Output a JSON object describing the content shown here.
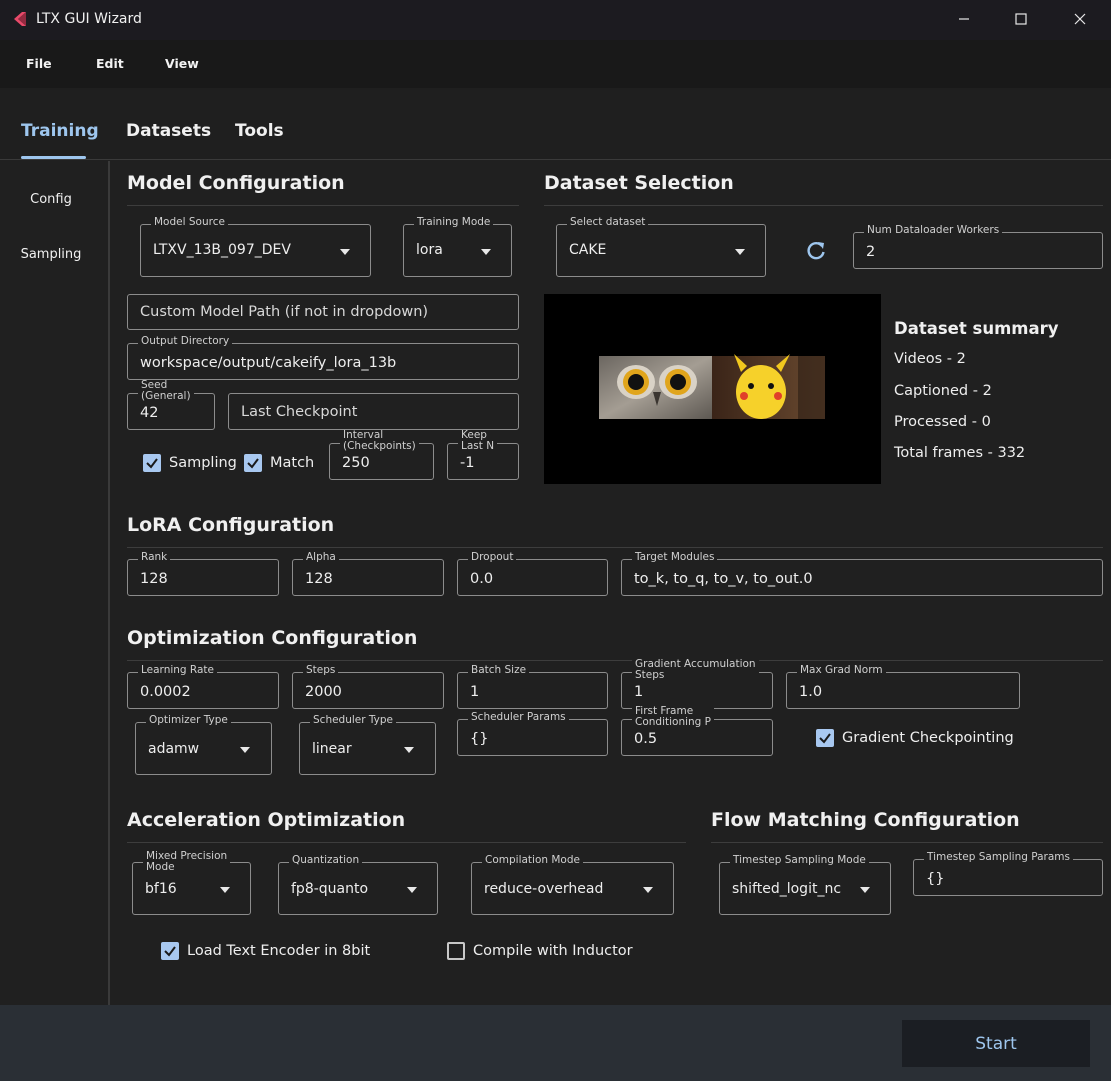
{
  "window": {
    "title": "LTX GUI Wizard"
  },
  "menu": {
    "file": "File",
    "edit": "Edit",
    "view": "View"
  },
  "tabs": {
    "training": "Training",
    "datasets": "Datasets",
    "tools": "Tools"
  },
  "sidenav": {
    "config": "Config",
    "sampling": "Sampling"
  },
  "model": {
    "title": "Model Configuration",
    "source_label": "Model Source",
    "source_value": "LTXV_13B_097_DEV",
    "mode_label": "Training Mode",
    "mode_value": "lora",
    "custom_path_placeholder": "Custom Model Path (if not in dropdown)",
    "output_label": "Output Directory",
    "output_value": "workspace/output/cakeify_lora_13b",
    "seed_label_1": "Seed",
    "seed_label_2": "(General)",
    "seed_value": "42",
    "last_checkpoint_placeholder": "Last Checkpoint",
    "sampling_label": "Sampling",
    "match_label": "Match",
    "interval_label_1": "Interval",
    "interval_label_2": "(Checkpoints)",
    "interval_value": "250",
    "keep_label_1": "Keep",
    "keep_label_2": "Last N",
    "keep_value": "-1"
  },
  "dataset": {
    "title": "Dataset Selection",
    "select_label": "Select dataset",
    "select_value": "CAKE",
    "workers_label": "Num Dataloader Workers",
    "workers_value": "2",
    "summary_title": "Dataset summary",
    "videos": "Videos - 2",
    "captioned": "Captioned - 2",
    "processed": "Processed - 0",
    "frames": "Total frames - 332"
  },
  "lora": {
    "title": "LoRA Configuration",
    "rank_label": "Rank",
    "rank_value": "128",
    "alpha_label": "Alpha",
    "alpha_value": "128",
    "dropout_label": "Dropout",
    "dropout_value": "0.0",
    "modules_label": "Target Modules",
    "modules_value": "to_k, to_q, to_v, to_out.0"
  },
  "optim": {
    "title": "Optimization Configuration",
    "lr_label": "Learning Rate",
    "lr_value": "0.0002",
    "steps_label": "Steps",
    "steps_value": "2000",
    "batch_label": "Batch Size",
    "batch_value": "1",
    "grad_acc_label_1": "Gradient Accumulation",
    "grad_acc_label_2": "Steps",
    "grad_acc_value": "1",
    "max_grad_label": "Max Grad Norm",
    "max_grad_value": "1.0",
    "optimizer_label": "Optimizer Type",
    "optimizer_value": "adamw",
    "scheduler_label": "Scheduler Type",
    "scheduler_value": "linear",
    "sched_params_label": "Scheduler Params",
    "sched_params_value": "{}",
    "ffc_label_1": "First Frame",
    "ffc_label_2": "Conditioning P",
    "ffc_value": "0.5",
    "grad_ckpt_label": "Gradient Checkpointing"
  },
  "accel": {
    "title": "Acceleration Optimization",
    "precision_label_1": "Mixed Precision",
    "precision_label_2": "Mode",
    "precision_value": "bf16",
    "quant_label": "Quantization",
    "quant_value": "fp8-quanto",
    "compile_label": "Compilation Mode",
    "compile_value": "reduce-overhead",
    "load_8bit_label": "Load Text Encoder in 8bit",
    "inductor_label": "Compile with Inductor"
  },
  "flow": {
    "title": "Flow Matching Configuration",
    "ts_mode_label": "Timestep Sampling Mode",
    "ts_mode_value": "shifted_logit_nc",
    "ts_params_label": "Timestep Sampling Params",
    "ts_params_value": "{}"
  },
  "footer": {
    "start_label": "Start"
  },
  "colors": {
    "accent": "#9ec6ee",
    "checkbox": "#a8c8f0",
    "background": "#202020"
  },
  "checkbox_states": {
    "sampling": true,
    "match": true,
    "gradient_checkpointing": true,
    "load_8bit": true,
    "inductor": false
  }
}
